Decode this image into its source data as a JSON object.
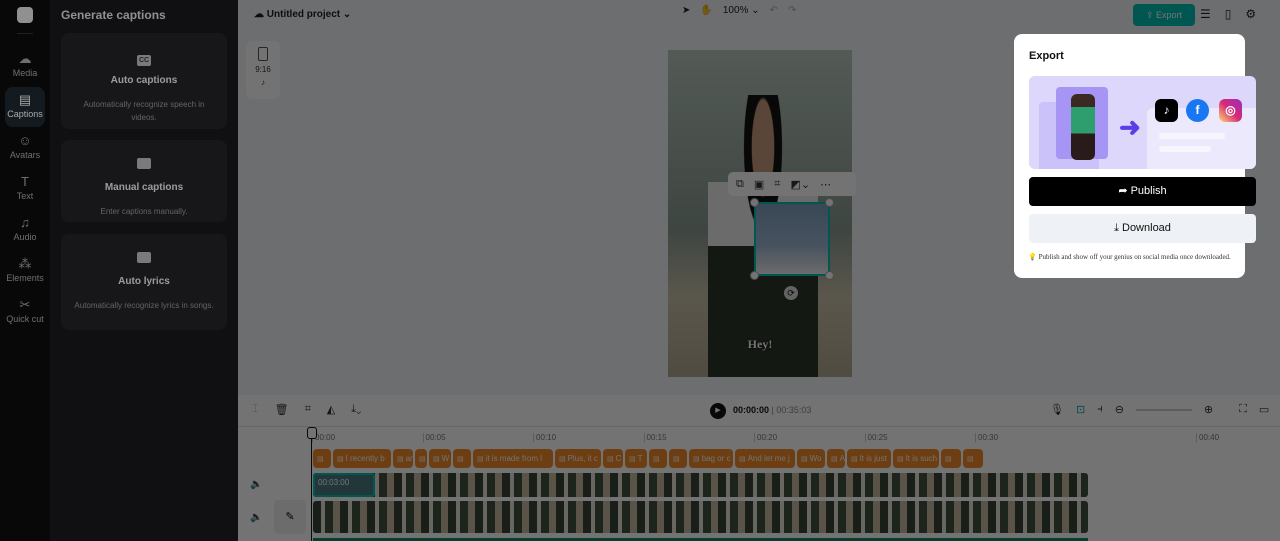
{
  "rail": {
    "items": [
      {
        "label": "Media",
        "icon": "cloud-upload-icon"
      },
      {
        "label": "Captions",
        "icon": "captions-icon",
        "active": true
      },
      {
        "label": "Avatars",
        "icon": "avatar-icon"
      },
      {
        "label": "Text",
        "icon": "text-icon"
      },
      {
        "label": "Audio",
        "icon": "music-icon"
      },
      {
        "label": "Elements",
        "icon": "elements-icon"
      },
      {
        "label": "Quick cut",
        "icon": "quick-cut-icon"
      }
    ]
  },
  "panel": {
    "title": "Generate captions",
    "cards": [
      {
        "title": "Auto captions",
        "desc": "Automatically recognize speech in videos.",
        "icon": "CC"
      },
      {
        "title": "Manual captions",
        "desc": "Enter captions manually.",
        "icon": ""
      },
      {
        "title": "Auto lyrics",
        "desc": "Automatically recognize lyrics in songs.",
        "icon": ""
      }
    ]
  },
  "topbar": {
    "project": "Untitled project",
    "zoom": "100%",
    "export": "Export"
  },
  "canvas": {
    "ratio": "9:16",
    "caption": "Hey!"
  },
  "timeline": {
    "current": "00:00:00",
    "total": "00:35:03",
    "clip_time": "00:03:00",
    "ruler": [
      "00:00",
      "00:05",
      "00:10",
      "00:15",
      "00:20",
      "00:25",
      "00:30",
      "00:40"
    ],
    "captions": [
      "",
      "I recently b",
      "and",
      "",
      "W",
      "",
      "it is made from l",
      "Plus, it c",
      "C",
      "T",
      "",
      "",
      "bag or c",
      "And let me j",
      "Wo",
      "A",
      "It is just",
      "It is such",
      "",
      ""
    ]
  },
  "export": {
    "title": "Export",
    "publish": "Publish",
    "download": "Download",
    "hint": "Publish and show off your genius on social media once downloaded.",
    "accent": "#00c1b5"
  }
}
